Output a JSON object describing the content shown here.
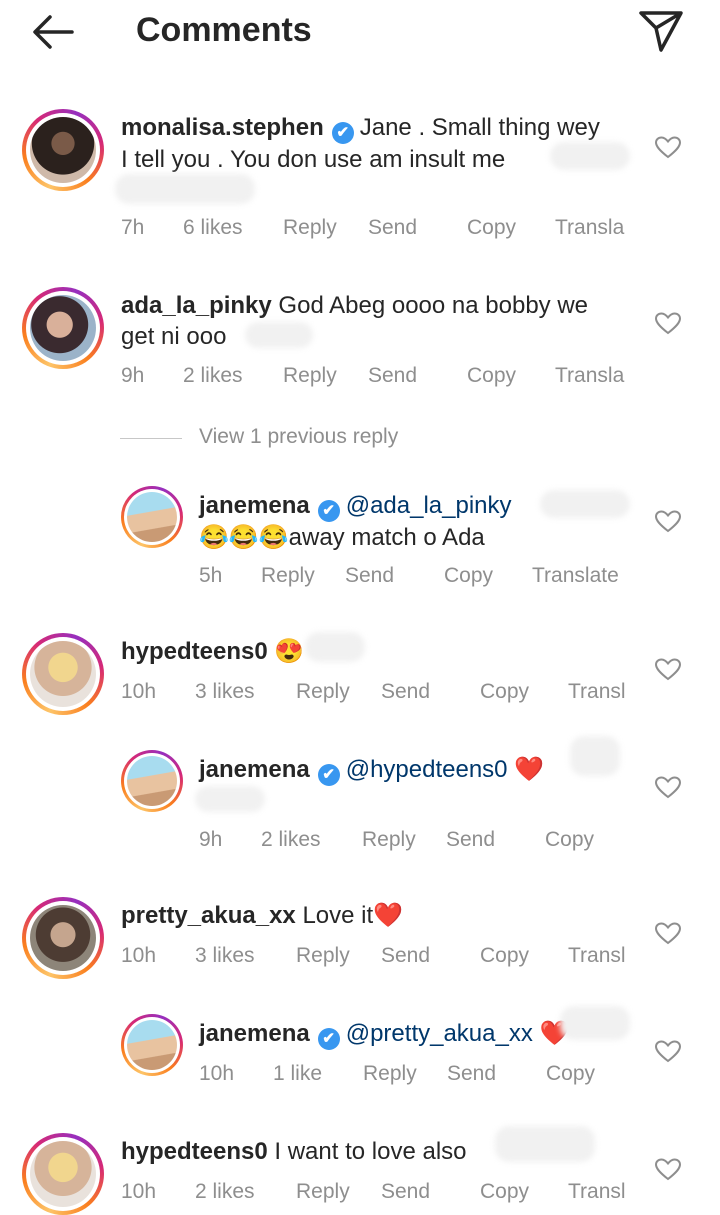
{
  "header": {
    "title": "Comments",
    "back_icon": "arrow-left-icon",
    "send_icon": "paper-plane-icon"
  },
  "verified_mark": "✔",
  "comments": [
    {
      "user": "monalisa.stephen",
      "verified": true,
      "text_line1": "Jane . Small thing wey",
      "text_line2": "I tell you . You don use am insult me",
      "time": "7h",
      "likes": "6 likes",
      "reply": "Reply",
      "send": "Send",
      "copy": "Copy",
      "translate": "Transla"
    },
    {
      "user": "ada_la_pinky",
      "verified": false,
      "text_line1": "God Abeg oooo na bobby we",
      "text_line2": "get ni ooo",
      "time": "9h",
      "likes": "2 likes",
      "reply": "Reply",
      "send": "Send",
      "copy": "Copy",
      "translate": "Transla"
    },
    {
      "user": "janemena",
      "verified": true,
      "mention": "@ada_la_pinky",
      "text_line2": "😂😂😂away match o Ada",
      "time": "5h",
      "reply": "Reply",
      "send": "Send",
      "copy": "Copy",
      "translate": "Translate"
    },
    {
      "user": "hypedteens0",
      "verified": false,
      "text": "😍",
      "time": "10h",
      "likes": "3 likes",
      "reply": "Reply",
      "send": "Send",
      "copy": "Copy",
      "translate": "Transl"
    },
    {
      "user": "janemena",
      "verified": true,
      "mention": "@hypedteens0",
      "text": "❤️",
      "time": "9h",
      "likes": "2 likes",
      "reply": "Reply",
      "send": "Send",
      "copy": "Copy"
    },
    {
      "user": "pretty_akua_xx",
      "verified": false,
      "text": "Love it❤️",
      "time": "10h",
      "likes": "3 likes",
      "reply": "Reply",
      "send": "Send",
      "copy": "Copy",
      "translate": "Transl"
    },
    {
      "user": "janemena",
      "verified": true,
      "mention": "@pretty_akua_xx",
      "text": "❤️",
      "time": "10h",
      "likes": "1 like",
      "reply": "Reply",
      "send": "Send",
      "copy": "Copy"
    },
    {
      "user": "hypedteens0",
      "verified": false,
      "text": "I want to love also",
      "time": "10h",
      "likes": "2 likes",
      "reply": "Reply",
      "send": "Send",
      "copy": "Copy",
      "translate": "Transl"
    }
  ],
  "view_previous_reply": "View 1 previous reply",
  "colors": {
    "text": "#262626",
    "meta": "#8e8e8e",
    "verified": "#3897f0",
    "mention": "#00376b",
    "heart": "#ed4956"
  }
}
